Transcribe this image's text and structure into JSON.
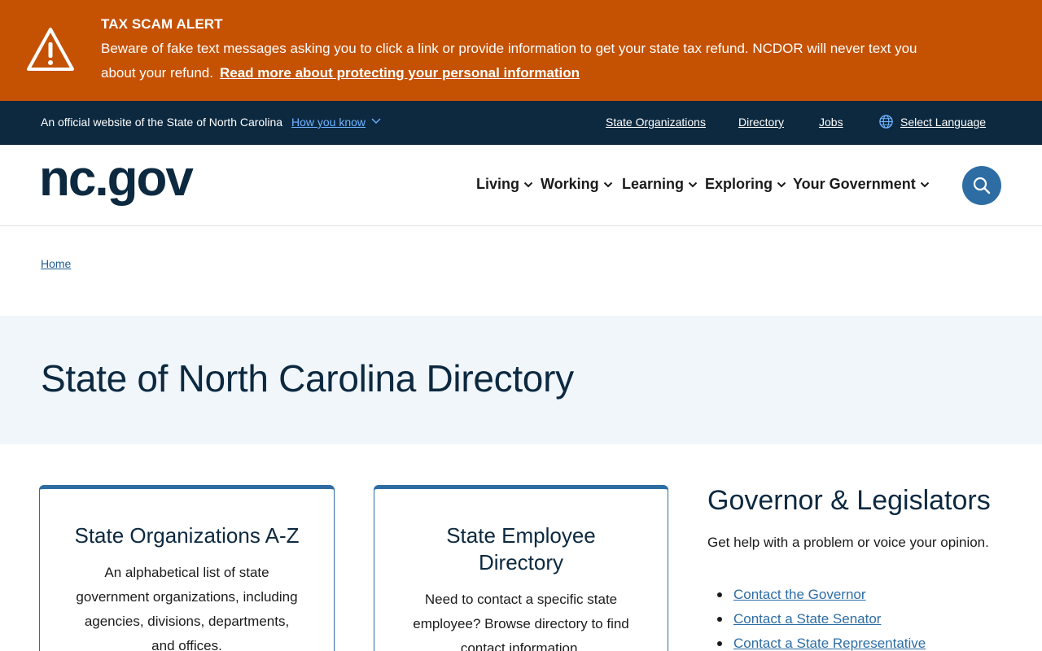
{
  "alert": {
    "title": "TAX SCAM ALERT",
    "body": "Beware of fake text messages asking you to click a link or provide information to get your state tax refund. NCDOR will never text you about your refund.",
    "link": "Read more about protecting your personal information",
    "icon": "warning-triangle-icon",
    "color": "#c55103"
  },
  "utility": {
    "official": "An official website of the State of North Carolina",
    "how_you_know": "How you know",
    "links": {
      "state_orgs": "State Organizations",
      "directory": "Directory",
      "jobs": "Jobs",
      "language": "Select Language"
    },
    "color": "#0c2940"
  },
  "header": {
    "logo": "nc.gov",
    "nav": [
      "Living",
      "Working",
      "Learning",
      "Exploring",
      "Your Government"
    ],
    "search_icon": "search-icon"
  },
  "breadcrumb": {
    "home": "Home"
  },
  "hero": {
    "title": "State of North Carolina Directory"
  },
  "cards": [
    {
      "title": "State Organizations A-Z",
      "body": "An alphabetical list of state government organizations, including agencies, divisions, departments, and offices."
    },
    {
      "title": "State Employee Directory",
      "body": "Need to contact a specific state employee? Browse directory to find contact information."
    }
  ],
  "governor": {
    "title": "Governor & Legislators",
    "subtitle": "Get help with a problem or voice your opinion.",
    "links": [
      "Contact the Governor",
      "Contact a State Senator",
      "Contact a State Representative"
    ]
  },
  "colors": {
    "accent": "#2e6da4",
    "navy": "#0c2940",
    "hero_bg": "#f1f6fb"
  }
}
